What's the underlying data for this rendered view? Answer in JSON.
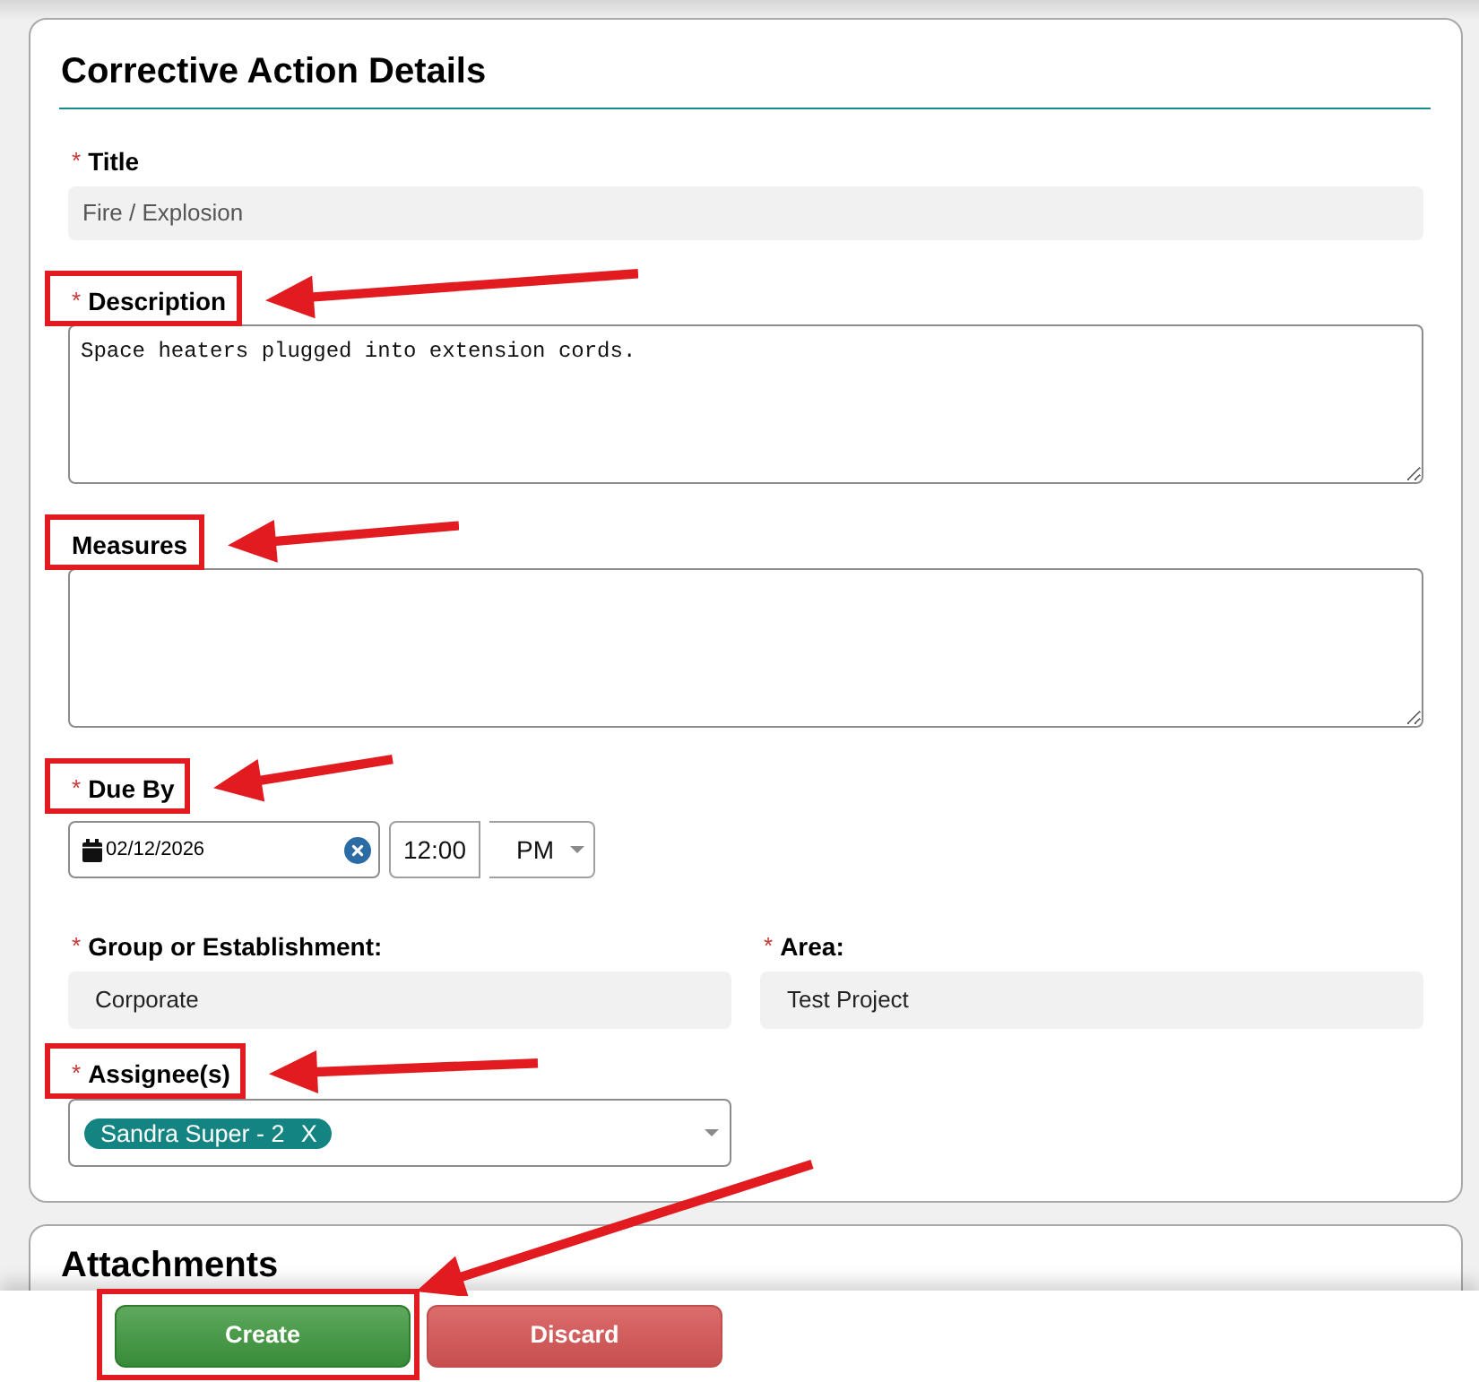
{
  "panel": {
    "title": "Corrective Action Details"
  },
  "rows": [
    {
      "fields": [
        {
          "kind": "static_text",
          "required_mark": "*",
          "label": "Title",
          "highlighted": false,
          "value": "Fire / Explosion"
        }
      ]
    },
    {
      "fields": [
        {
          "kind": "textarea",
          "required_mark": "*",
          "label": "Description",
          "highlighted": true,
          "value": "Space heaters plugged into extension cords."
        }
      ]
    },
    {
      "fields": [
        {
          "kind": "textarea",
          "label": "Measures",
          "highlighted": true
        }
      ]
    },
    {
      "fields": [
        {
          "kind": "datetime",
          "required_mark": "*",
          "label": "Due By",
          "highlighted": true,
          "date": "02/12/2026",
          "time": "12:00",
          "meridiem": "PM"
        }
      ]
    },
    {
      "fields": [
        {
          "kind": "static_choice",
          "required_mark": "*",
          "label": "Group or Establishment:",
          "highlighted": false,
          "value": "Corporate"
        },
        {
          "kind": "static_choice",
          "required_mark": "*",
          "label": "Area:",
          "highlighted": false,
          "value": "Test Project"
        }
      ]
    },
    {
      "fields": [
        {
          "kind": "multiselect",
          "required_mark": "*",
          "label": "Assignee(s)",
          "highlighted": true,
          "tags": [
            {
              "text": "Sandra Super - 2",
              "remove": "X"
            }
          ]
        }
      ]
    }
  ],
  "attachments": {
    "title": "Attachments"
  },
  "actions": [
    {
      "kind": "create",
      "label": "Create",
      "highlighted": true
    },
    {
      "kind": "discard",
      "label": "Discard",
      "highlighted": false
    }
  ]
}
